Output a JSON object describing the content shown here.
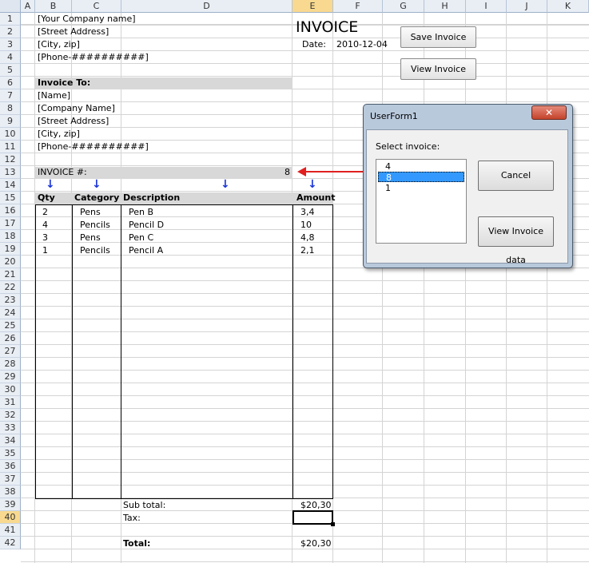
{
  "columns": [
    "A",
    "B",
    "C",
    "D",
    "E",
    "F",
    "G",
    "H",
    "I",
    "J",
    "K"
  ],
  "selected_column": "E",
  "selected_row": "40",
  "rows": [
    "1",
    "2",
    "3",
    "4",
    "5",
    "6",
    "7",
    "8",
    "9",
    "10",
    "11",
    "12",
    "13",
    "14",
    "15",
    "16",
    "17",
    "18",
    "19",
    "20",
    "21",
    "22",
    "23",
    "24",
    "25",
    "26",
    "27",
    "28",
    "29",
    "30",
    "31",
    "32",
    "33",
    "34",
    "35",
    "36",
    "37",
    "38",
    "39",
    "40",
    "41",
    "42"
  ],
  "company": {
    "name": "[Your Company name]",
    "street": "[Street Address]",
    "city": "[City, zip]",
    "phone": "[Phone-##########]"
  },
  "invoice_title": "INVOICE",
  "date_label": "Date:",
  "date_value": "2010-12-04",
  "invoice_to": {
    "heading": "Invoice To:",
    "name": "[Name]",
    "company": "[Company Name]",
    "street": "[Street Address]",
    "city": "[City, zip]",
    "phone": "[Phone-##########]"
  },
  "invoice_num_label": "INVOICE #:",
  "invoice_num_value": "8",
  "table": {
    "headers": {
      "qty": "Qty",
      "category": "Category",
      "description": "Description",
      "amount": "Amount"
    },
    "rows": [
      {
        "qty": "2",
        "category": "Pens",
        "description": "Pen B",
        "amount": "3,4"
      },
      {
        "qty": "4",
        "category": "Pencils",
        "description": "Pencil D",
        "amount": "10"
      },
      {
        "qty": "3",
        "category": "Pens",
        "description": "Pen C",
        "amount": "4,8"
      },
      {
        "qty": "1",
        "category": "Pencils",
        "description": "Pencil A",
        "amount": "2,1"
      }
    ]
  },
  "subtotal_label": "Sub total:",
  "subtotal_value": "$20,30",
  "tax_label": "Tax:",
  "total_label": "Total:",
  "total_value": "$20,30",
  "buttons": {
    "save": "Save Invoice",
    "view": "View Invoice"
  },
  "dialog": {
    "title": "UserForm1",
    "close": "✕",
    "select_label": "Select invoice:",
    "items": [
      "4",
      "8",
      "1"
    ],
    "selected_item": "8",
    "cancel": "Cancel",
    "view_data": "View Invoice data"
  },
  "colors": {
    "arrow_blue": "#1a35d8",
    "arrow_red": "#e02020",
    "selection": "#3399ff"
  }
}
